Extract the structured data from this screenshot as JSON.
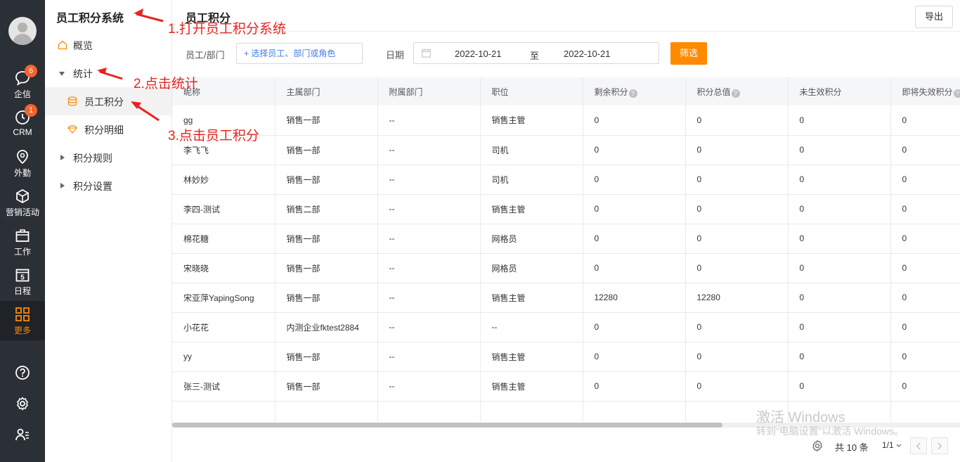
{
  "rail": {
    "items": [
      {
        "label": "企信",
        "badge": "6"
      },
      {
        "label": "CRM",
        "badge": "1"
      },
      {
        "label": "外勤"
      },
      {
        "label": "营销活动"
      },
      {
        "label": "工作"
      },
      {
        "label": "日程",
        "cal_num": "5"
      },
      {
        "label": "更多"
      }
    ]
  },
  "sidebar": {
    "title": "员工积分系统",
    "items": [
      {
        "label": "概览"
      },
      {
        "label": "统计"
      },
      {
        "label": "员工积分"
      },
      {
        "label": "积分明细"
      },
      {
        "label": "积分规则"
      },
      {
        "label": "积分设置"
      }
    ]
  },
  "main": {
    "title": "员工积分",
    "export_label": "导出",
    "filter": {
      "emp_label": "员工/部门",
      "emp_placeholder": "+ 选择员工、部门或角色",
      "date_label": "日期",
      "date_from": "2022-10-21",
      "date_sep": "至",
      "date_to": "2022-10-21",
      "filter_button": "筛选"
    },
    "table": {
      "columns": [
        "昵称",
        "主属部门",
        "附属部门",
        "职位",
        "剩余积分",
        "积分总值",
        "未生效积分",
        "即将失效积分"
      ],
      "rows": [
        [
          "gg",
          "销售一部",
          "--",
          "销售主管",
          "0",
          "0",
          "0",
          "0"
        ],
        [
          "李飞飞",
          "销售一部",
          "--",
          "司机",
          "0",
          "0",
          "0",
          "0"
        ],
        [
          "林妙妙",
          "销售一部",
          "--",
          "司机",
          "0",
          "0",
          "0",
          "0"
        ],
        [
          "李四-测试",
          "销售二部",
          "--",
          "销售主管",
          "0",
          "0",
          "0",
          "0"
        ],
        [
          "棉花糖",
          "销售一部",
          "--",
          "网格员",
          "0",
          "0",
          "0",
          "0"
        ],
        [
          "宋晓晓",
          "销售一部",
          "--",
          "网格员",
          "0",
          "0",
          "0",
          "0"
        ],
        [
          "宋亚萍YapingSong",
          "销售一部",
          "--",
          "销售主管",
          "12280",
          "12280",
          "0",
          "0"
        ],
        [
          "小花花",
          "内测企业fktest2884",
          "--",
          "--",
          "0",
          "0",
          "0",
          "0"
        ],
        [
          "yy",
          "销售一部",
          "--",
          "销售主管",
          "0",
          "0",
          "0",
          "0"
        ],
        [
          "张三-测试",
          "销售一部",
          "--",
          "销售主管",
          "0",
          "0",
          "0",
          "0"
        ]
      ]
    },
    "pager": {
      "total": "共 10 条",
      "page": "1/1"
    }
  },
  "watermark": {
    "line1": "激活 Windows",
    "line2": "转到“电脑设置”以激活 Windows。"
  },
  "annotations": {
    "step1": "1.打开员工积分系统",
    "step2": "2.点击统计",
    "step3": "3.点击员工积分"
  },
  "colors": {
    "accent": "#ff8a00",
    "rail_bg": "#2b2f36",
    "badge": "#f5632d",
    "annotation": "#e8231d",
    "link_blue": "#3b7ce8"
  }
}
